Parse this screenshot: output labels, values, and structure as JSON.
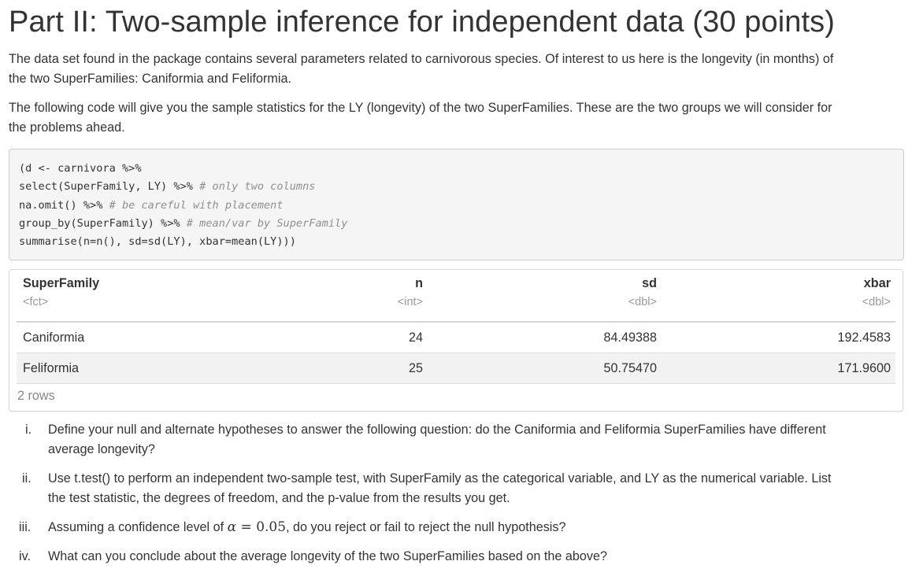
{
  "title": "Part II: Two-sample inference for independent data (30 points)",
  "paragraphs": {
    "intro_line1": "The data set found in the package contains several parameters related to carnivorous species. Of interest to us here is the longevity (in months) of",
    "intro_line2": "the two SuperFamilies: Caniformia and Feliformia.",
    "code_intro_line1": "The following code will give you the sample statistics for the LY (longevity) of the two SuperFamilies. These are the two groups we will consider for",
    "code_intro_line2": "the problems ahead."
  },
  "code": {
    "line1": "(d <- carnivora %>%",
    "line2_code": "select(SuperFamily, LY) %>% ",
    "line2_comment": "# only two columns",
    "line3_code": "na.omit() %>% ",
    "line3_comment": "# be careful with placement",
    "line4_code": "group_by(SuperFamily) %>% ",
    "line4_comment": "# mean/var by SuperFamily",
    "line5": "summarise(n=n(), sd=sd(LY), xbar=mean(LY)))"
  },
  "table": {
    "columns": [
      {
        "name": "SuperFamily",
        "type": "<fct>"
      },
      {
        "name": "n",
        "type": "<int>"
      },
      {
        "name": "sd",
        "type": "<dbl>"
      },
      {
        "name": "xbar",
        "type": "<dbl>"
      }
    ],
    "rows": [
      [
        "Caniformia",
        "24",
        "84.49388",
        "192.4583"
      ],
      [
        "Feliformia",
        "25",
        "50.75470",
        "171.9600"
      ]
    ],
    "row_count": "2 rows"
  },
  "questions": [
    {
      "num": "i.",
      "line1": "Define your null and alternate hypotheses to answer the following question: do the Caniformia and Feliformia SuperFamilies have different",
      "line2": "average longevity?"
    },
    {
      "num": "ii.",
      "line1": "Use t.test() to perform an independent two-sample test, with SuperFamily as the categorical variable, and LY as the numerical variable. List",
      "line2": "the test statistic, the degrees of freedom, and the p-value from the results you get."
    },
    {
      "num": "iii.",
      "before": "Assuming a confidence level of ",
      "math_symbol": "α",
      "math_eq": " = ",
      "math_value": "0.05",
      "after": ", do you reject or fail to reject the null hypothesis?"
    },
    {
      "num": "iv.",
      "line1": "What can you conclude about the average longevity of the two SuperFamilies based on the above?"
    }
  ]
}
